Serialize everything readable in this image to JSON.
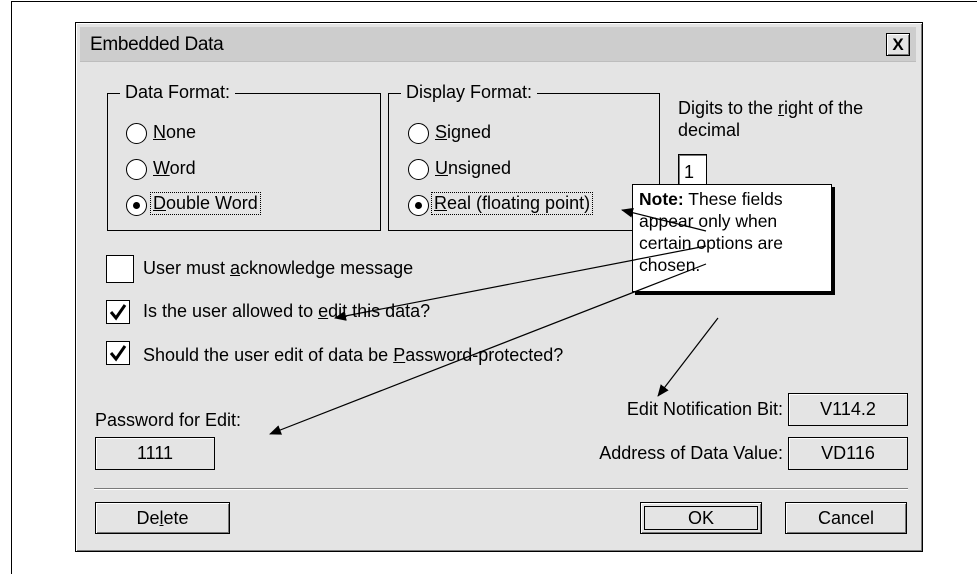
{
  "dialog": {
    "title": "Embedded Data",
    "close_glyph": "X"
  },
  "data_format": {
    "legend": "Data Format:",
    "options": [
      {
        "pre": "",
        "accel": "N",
        "post": "one",
        "selected": false
      },
      {
        "pre": "",
        "accel": "W",
        "post": "ord",
        "selected": false
      },
      {
        "pre": "",
        "accel": "D",
        "post": "ouble Word",
        "selected": true
      }
    ]
  },
  "display_format": {
    "legend": "Display Format:",
    "options": [
      {
        "pre": "",
        "accel": "S",
        "post": "igned",
        "selected": false
      },
      {
        "pre": "",
        "accel": "U",
        "post": "nsigned",
        "selected": false
      },
      {
        "pre": "",
        "accel": "R",
        "post": "eal (floating point)",
        "selected": true
      }
    ]
  },
  "digits": {
    "label_line1_pre": "Digits to the ",
    "label_line1_accel": "r",
    "label_line1_post": "ight of the",
    "label_line2": "decimal",
    "value": "1"
  },
  "checkboxes": [
    {
      "pre": "User must ",
      "accel": "a",
      "post": "cknowledge message",
      "checked": false
    },
    {
      "pre": "Is the user allowed to ",
      "accel": "e",
      "post": "dit this data?",
      "checked": true
    },
    {
      "pre": "Should the user edit of data be ",
      "accel": "P",
      "post": "assword-protected?",
      "checked": true
    }
  ],
  "password": {
    "label": "Password for Edit:",
    "value": "1111"
  },
  "edit_notification": {
    "label": "Edit Notification Bit:",
    "value": "V114.2"
  },
  "data_address": {
    "label": "Address of Data Value:",
    "value": "VD116"
  },
  "note": {
    "bold": "Note:",
    "text_line1": " These fields",
    "text_line2": "appear only when",
    "text_line3": "certain options are",
    "text_line4": "chosen."
  },
  "buttons": {
    "delete_pre": "De",
    "delete_accel": "l",
    "delete_post": "ete",
    "ok": "OK",
    "cancel": "Cancel"
  }
}
